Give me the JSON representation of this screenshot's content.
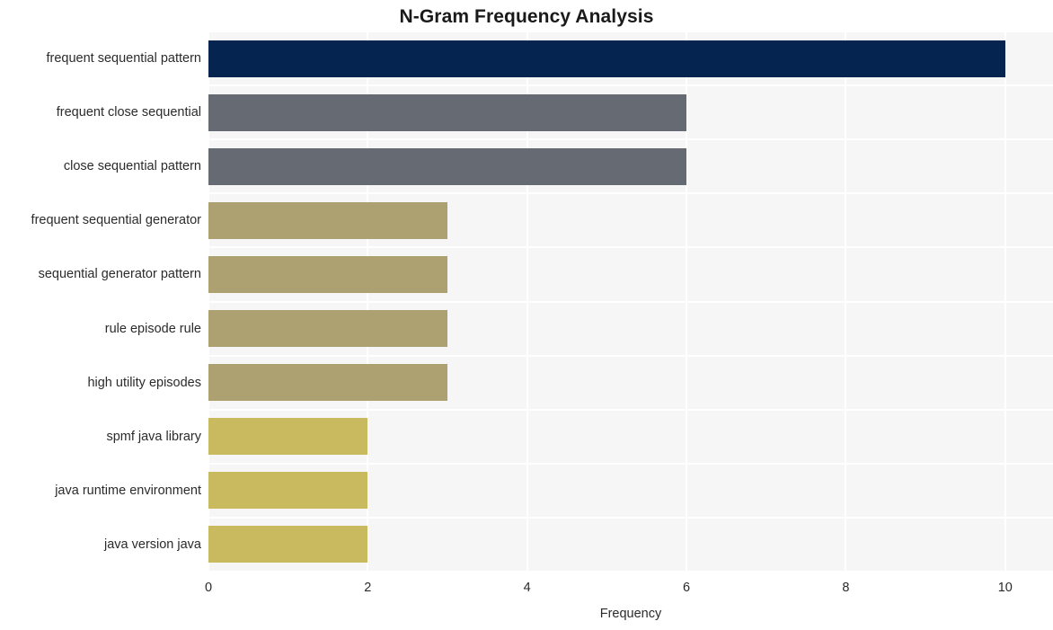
{
  "chart_data": {
    "type": "bar",
    "orientation": "horizontal",
    "title": "N-Gram Frequency Analysis",
    "xlabel": "Frequency",
    "ylabel": "",
    "xlim": [
      0,
      10.6
    ],
    "xticks": [
      0,
      2,
      4,
      6,
      8,
      10
    ],
    "xtick_labels": [
      "0",
      "2",
      "4",
      "6",
      "8",
      "10"
    ],
    "grid": true,
    "legend": false,
    "categories": [
      "frequent sequential pattern",
      "frequent close sequential",
      "close sequential pattern",
      "frequent sequential generator",
      "sequential generator pattern",
      "rule episode rule",
      "high utility episodes",
      "spmf java library",
      "java runtime environment",
      "java version java"
    ],
    "values": [
      10,
      6,
      6,
      3,
      3,
      3,
      3,
      2,
      2,
      2
    ],
    "bar_colors": [
      "#052450",
      "#666a73",
      "#666a73",
      "#ada071",
      "#ada071",
      "#ada071",
      "#ada071",
      "#c9ba5f",
      "#c9ba5f",
      "#c9ba5f"
    ],
    "plot_background": "#f6f6f7",
    "gridline_color": "#ffffff",
    "figure_background": "#ffffff"
  }
}
